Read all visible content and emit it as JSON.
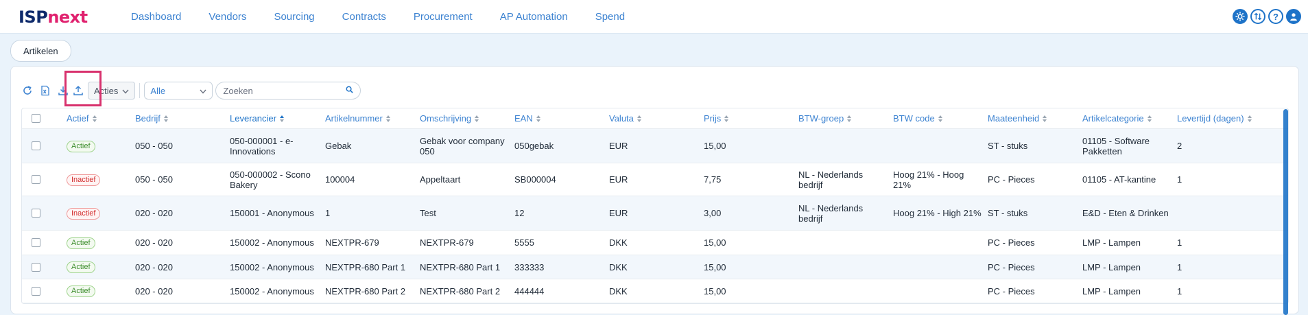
{
  "app": {
    "logo_part1": "ISP",
    "logo_part2": "next"
  },
  "nav": {
    "items": [
      {
        "label": "Dashboard"
      },
      {
        "label": "Vendors"
      },
      {
        "label": "Sourcing"
      },
      {
        "label": "Contracts"
      },
      {
        "label": "Procurement"
      },
      {
        "label": "AP Automation"
      },
      {
        "label": "Spend"
      }
    ]
  },
  "top_icons": {
    "settings": "gear-icon",
    "sync": "sync-icon",
    "help": "?",
    "user": "user-icon"
  },
  "tab": {
    "label": "Artikelen"
  },
  "toolbar": {
    "acties_label": "Acties",
    "filter_value": "Alle",
    "search_placeholder": "Zoeken"
  },
  "table": {
    "headers": [
      "Actief",
      "Bedrijf",
      "Leverancier",
      "Artikelnummer",
      "Omschrijving",
      "EAN",
      "Valuta",
      "Prijs",
      "BTW-groep",
      "BTW code",
      "Maateenheid",
      "Artikelcategorie",
      "Levertijd (dagen)"
    ],
    "rows": [
      {
        "status": "Actief",
        "active": true,
        "bedrijf": "050 - 050",
        "leverancier": "050-000001 - e-Innovations",
        "artikelnummer": "Gebak",
        "omschrijving": "Gebak voor company 050",
        "ean": "050gebak",
        "valuta": "EUR",
        "prijs": "15,00",
        "btw_groep": "",
        "btw_code": "",
        "maateenheid": "ST - stuks",
        "categorie": "01105 - Software Pakketten",
        "levertijd": "2"
      },
      {
        "status": "Inactief",
        "active": false,
        "bedrijf": "050 - 050",
        "leverancier": "050-000002 - Scono Bakery",
        "artikelnummer": "100004",
        "omschrijving": "Appeltaart",
        "ean": "SB000004",
        "valuta": "EUR",
        "prijs": "7,75",
        "btw_groep": "NL - Nederlands bedrijf",
        "btw_code": "Hoog 21% - Hoog 21%",
        "maateenheid": "PC - Pieces",
        "categorie": "01105 - AT-kantine",
        "levertijd": "1"
      },
      {
        "status": "Inactief",
        "active": false,
        "bedrijf": "020 - 020",
        "leverancier": "150001 - Anonymous",
        "artikelnummer": "1",
        "omschrijving": "Test",
        "ean": "12",
        "valuta": "EUR",
        "prijs": "3,00",
        "btw_groep": "NL - Nederlands bedrijf",
        "btw_code": "Hoog 21% - High 21%",
        "maateenheid": "ST - stuks",
        "categorie": "E&D - Eten & Drinken",
        "levertijd": ""
      },
      {
        "status": "Actief",
        "active": true,
        "bedrijf": "020 - 020",
        "leverancier": "150002 - Anonymous",
        "artikelnummer": "NEXTPR-679",
        "omschrijving": "NEXTPR-679",
        "ean": "5555",
        "valuta": "DKK",
        "prijs": "15,00",
        "btw_groep": "",
        "btw_code": "",
        "maateenheid": "PC - Pieces",
        "categorie": "LMP - Lampen",
        "levertijd": "1"
      },
      {
        "status": "Actief",
        "active": true,
        "bedrijf": "020 - 020",
        "leverancier": "150002 - Anonymous",
        "artikelnummer": "NEXTPR-680 Part 1",
        "omschrijving": "NEXTPR-680 Part 1",
        "ean": "333333",
        "valuta": "DKK",
        "prijs": "15,00",
        "btw_groep": "",
        "btw_code": "",
        "maateenheid": "PC - Pieces",
        "categorie": "LMP - Lampen",
        "levertijd": "1"
      },
      {
        "status": "Actief",
        "active": true,
        "bedrijf": "020 - 020",
        "leverancier": "150002 - Anonymous",
        "artikelnummer": "NEXTPR-680 Part 2",
        "omschrijving": "NEXTPR-680 Part 2",
        "ean": "444444",
        "valuta": "DKK",
        "prijs": "15,00",
        "btw_groep": "",
        "btw_code": "",
        "maateenheid": "PC - Pieces",
        "categorie": "LMP - Lampen",
        "levertijd": "1"
      }
    ]
  }
}
